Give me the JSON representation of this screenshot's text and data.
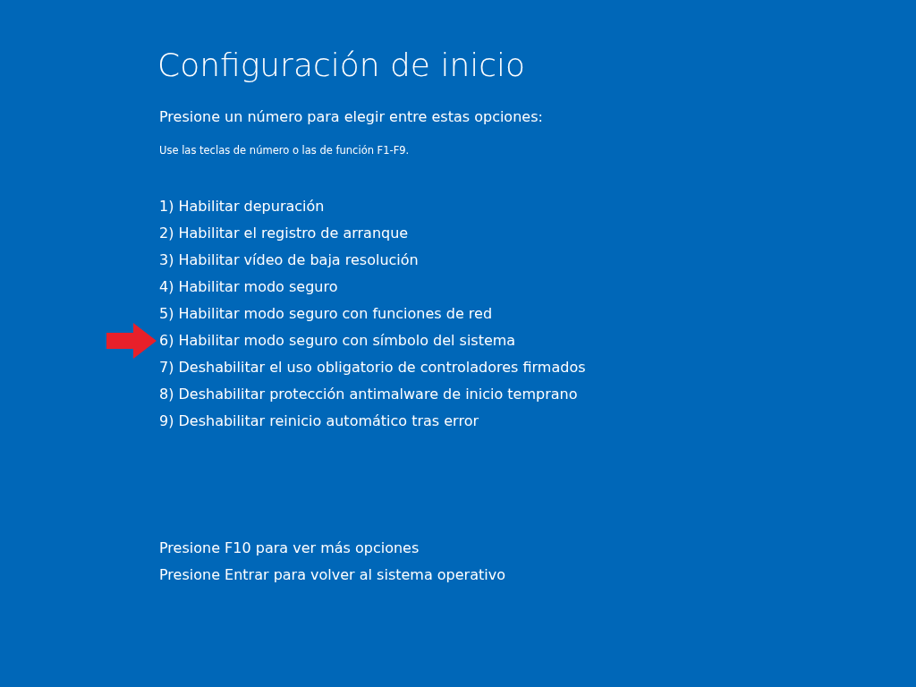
{
  "title": "Configuración de inicio",
  "prompt": "Presione un número para elegir entre estas opciones:",
  "hint": "Use las teclas de número o las de función F1-F9.",
  "options": [
    {
      "label": "1) Habilitar depuración",
      "arrow": false
    },
    {
      "label": "2) Habilitar el registro de arranque",
      "arrow": false
    },
    {
      "label": "3) Habilitar vídeo de baja resolución",
      "arrow": false
    },
    {
      "label": "4) Habilitar modo seguro",
      "arrow": false
    },
    {
      "label": "5) Habilitar modo seguro con funciones de red",
      "arrow": false
    },
    {
      "label": "6) Habilitar modo seguro con símbolo del sistema",
      "arrow": true
    },
    {
      "label": "7) Deshabilitar el uso obligatorio de controladores firmados",
      "arrow": false
    },
    {
      "label": "8) Deshabilitar protección antimalware de inicio temprano",
      "arrow": false
    },
    {
      "label": "9) Deshabilitar reinicio automático tras error",
      "arrow": false
    }
  ],
  "footer": [
    "Presione F10 para ver más opciones",
    "Presione Entrar para volver al sistema operativo"
  ]
}
